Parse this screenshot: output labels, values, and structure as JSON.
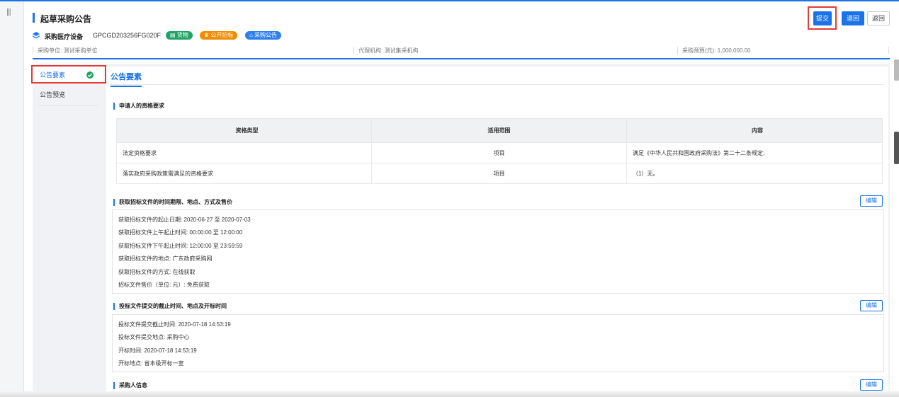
{
  "app": {
    "menu_icon": "hamburger-icon",
    "accent_color": "#1a73e8"
  },
  "header": {
    "title": "起草采购公告",
    "buttons": {
      "submit": "提交",
      "reject": "退回",
      "back": "返回"
    }
  },
  "project": {
    "name": "采购医疗设备",
    "code": "GPCGD203256FG020F",
    "badges": [
      {
        "label": "▤ 货物",
        "color": "#21a366"
      },
      {
        "label": "♛ 公开招标",
        "color": "#f08c00"
      },
      {
        "label": "⌂ 采购公告",
        "color": "#2f80ed"
      }
    ],
    "purchaser": "采购单位: 测试采购单位",
    "agency": "代理机构: 测试集采机构",
    "budget": "采购预算(元): 1,000,000.00"
  },
  "sidenav": {
    "items": [
      {
        "label": "公告要素",
        "active": true
      },
      {
        "label": "公告预览",
        "active": false
      }
    ]
  },
  "panel": {
    "title": "公告要素",
    "edit_label": "编辑",
    "qualification": {
      "title": "申请人的资格要求",
      "columns": [
        "资格类型",
        "适用范围",
        "内容"
      ],
      "rows": [
        [
          "法定资格要求",
          "项目",
          "满足《中华人民共和国政府采购法》第二十二条规定;"
        ],
        [
          "落实政府采购政策需满足的资格要求",
          "项目",
          "（1）无。"
        ]
      ]
    },
    "bid_docs": {
      "title": "获取招标文件的时间期限、地点、方式及售价",
      "lines": [
        "获取招标文件的起止日期:  2020-06-27 至 2020-07-03",
        "获取招标文件上午起止时间:  00:00:00 至 12:00:00",
        "获取招标文件下午起止时间:  12:00:00 至 23:59:59",
        "获取招标文件的地点:  广东政府采购网",
        "获取招标文件的方式:  在线获取",
        "招标文件售价（单位: 元）:  免费获取"
      ]
    },
    "deadline": {
      "title": "投标文件提交的截止时间、地点及开标时间",
      "lines": [
        "投标文件提交截止时间:  2020-07-18 14:53:19",
        "投标文件提交地点:  采购中心",
        "开标时间:  2020-07-18 14:53:19",
        "开标地点:  省本级开标一室"
      ]
    },
    "purchaser_info": {
      "title": "采购人信息"
    }
  }
}
